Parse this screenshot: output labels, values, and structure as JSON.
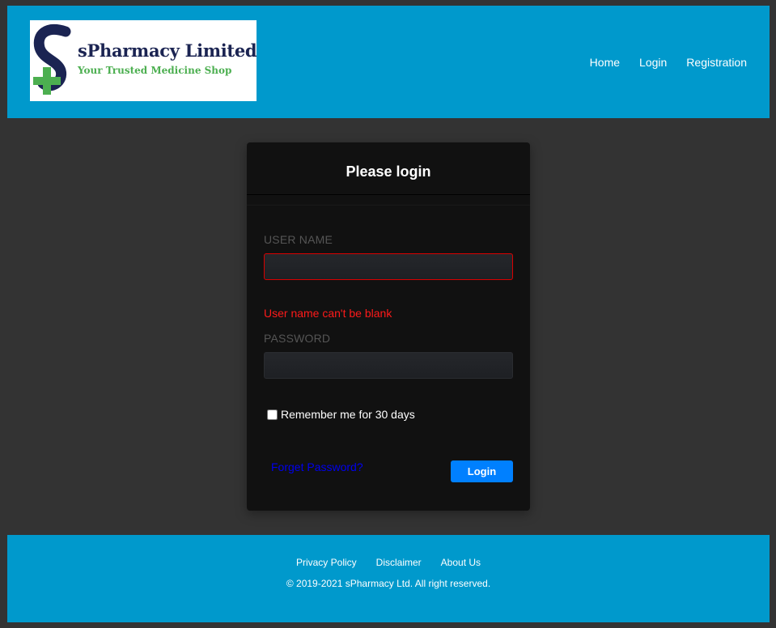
{
  "brand": {
    "name": "sPharmacy Limited",
    "tagline": "Your Trusted Medicine Shop",
    "logo_icon": "s-letter-with-medical-cross",
    "colors": {
      "navy": "#1b2452",
      "green": "#4caf50"
    }
  },
  "nav": {
    "items": [
      {
        "label": "Home"
      },
      {
        "label": "Login"
      },
      {
        "label": "Registration"
      }
    ]
  },
  "login": {
    "title": "Please login",
    "username_label": "USER NAME",
    "username_value": "",
    "username_error": "User name can't be blank",
    "password_label": "PASSWORD",
    "password_value": "",
    "remember_label": "Remember me for 30 days",
    "remember_checked": false,
    "forgot_label": "Forget Password?",
    "submit_label": "Login"
  },
  "footer": {
    "links": [
      {
        "label": "Privacy Policy"
      },
      {
        "label": "Disclaimer"
      },
      {
        "label": "About Us"
      }
    ],
    "copyright": "© 2019-2021 sPharmacy Ltd. All right reserved."
  },
  "colors": {
    "header_bg": "#0099cc",
    "page_bg": "#333333",
    "card_bg": "#111111",
    "accent_button": "#0080ff",
    "error": "#ff1a1a"
  }
}
